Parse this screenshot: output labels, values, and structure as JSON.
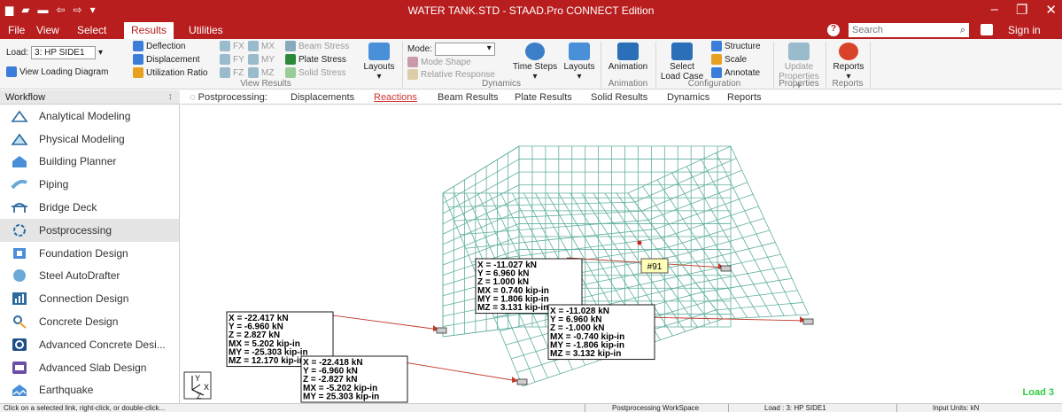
{
  "window": {
    "title": "WATER TANK.STD - STAAD.Pro CONNECT Edition",
    "sign_in": "Sign in"
  },
  "colors": {
    "brand": "#b81e1e",
    "mesh": "#5fae9f",
    "leader": "#c0392b",
    "load_label": "#2ecc40"
  },
  "menu": {
    "file": "File",
    "view": "View",
    "select": "Select",
    "results": "Results",
    "utilities": "Utilities"
  },
  "search": {
    "placeholder": "Search",
    "icon": "search-icon"
  },
  "ribbon": {
    "load_label": "Load:",
    "load_value": "3: HP SIDE1",
    "view_loading": "View Loading Diagram",
    "deflection": "Deflection",
    "displacement": "Displacement",
    "utilization": "Utilization Ratio",
    "fx": "FX",
    "mx": "MX",
    "fy": "FY",
    "my": "MY",
    "fz": "FZ",
    "mz": "MZ",
    "beam_stress": "Beam Stress",
    "plate_stress": "Plate Stress",
    "solid_stress": "Solid Stress",
    "layouts": "Layouts",
    "mode": "Mode:",
    "mode_shape": "Mode Shape",
    "relative_response": "Relative Response",
    "time_steps": "Time Steps",
    "layouts2": "Layouts",
    "animation": "Animation",
    "select_load_case": "Select Load Case",
    "structure": "Structure",
    "scale": "Scale",
    "annotate": "Annotate",
    "update_properties": "Update Properties",
    "reports": "Reports",
    "groups": {
      "view_results": "View Results",
      "dynamics": "Dynamics",
      "animation": "Animation",
      "configuration": "Configuration",
      "properties": "Properties",
      "reports": "Reports"
    }
  },
  "workflow": {
    "title": "Workflow",
    "pin": "↕",
    "items": [
      {
        "label": "Analytical Modeling",
        "icon": "analytical-modeling-icon"
      },
      {
        "label": "Physical Modeling",
        "icon": "physical-modeling-icon"
      },
      {
        "label": "Building Planner",
        "icon": "building-planner-icon"
      },
      {
        "label": "Piping",
        "icon": "piping-icon"
      },
      {
        "label": "Bridge Deck",
        "icon": "bridge-deck-icon"
      },
      {
        "label": "Postprocessing",
        "icon": "postprocessing-icon"
      },
      {
        "label": "Foundation Design",
        "icon": "foundation-design-icon"
      },
      {
        "label": "Steel AutoDrafter",
        "icon": "steel-autodrafter-icon"
      },
      {
        "label": "Connection Design",
        "icon": "connection-design-icon"
      },
      {
        "label": "Concrete Design",
        "icon": "concrete-design-icon"
      },
      {
        "label": "Advanced Concrete Desi...",
        "icon": "advanced-concrete-icon"
      },
      {
        "label": "Advanced Slab Design",
        "icon": "advanced-slab-icon"
      },
      {
        "label": "Earthquake",
        "icon": "earthquake-icon"
      }
    ]
  },
  "pp_tabs": {
    "prefix": "Postprocessing:",
    "items": [
      "Displacements",
      "Reactions",
      "Beam Results",
      "Plate Results",
      "Solid Results",
      "Dynamics",
      "Reports"
    ],
    "active_index": 1
  },
  "viewport": {
    "node_tag": "#91",
    "load_label": "Load 3",
    "reaction_boxes": [
      {
        "lines": [
          "X = -22.417 kN",
          "Y = -6.960 kN",
          "Z = 2.827 kN",
          "MX = 5.202 kip-in",
          "MY = -25.303 kip-in",
          "MZ = 12.170 kip-in"
        ]
      },
      {
        "lines": [
          "X = -22.418 kN",
          "Y = -6.960 kN",
          "Z = -2.827 kN",
          "MX = -5.202 kip-in",
          "MY = 25.303 kip-in"
        ]
      },
      {
        "lines": [
          "X = -11.027 kN",
          "Y = 6.960 kN",
          "Z = 1.000 kN",
          "MX = 0.740 kip-in",
          "MY = 1.806 kip-in",
          "MZ = 3.131 kip-in"
        ]
      },
      {
        "lines": [
          "X = -11.028 kN",
          "Y = 6.960 kN",
          "Z = -1.000 kN",
          "MX = -0.740 kip-in",
          "MY = -1.806 kip-in",
          "MZ = 3.132 kip-in"
        ]
      }
    ],
    "axis": {
      "y": "Y",
      "x": "X",
      "z": "Z"
    }
  },
  "status": {
    "hint": "Click on a selected link, right-click, or double-click...",
    "mode": "Postprocessing WorkSpace",
    "load": "Load : 3: HP SIDE1",
    "units": "Input Units: kN"
  }
}
